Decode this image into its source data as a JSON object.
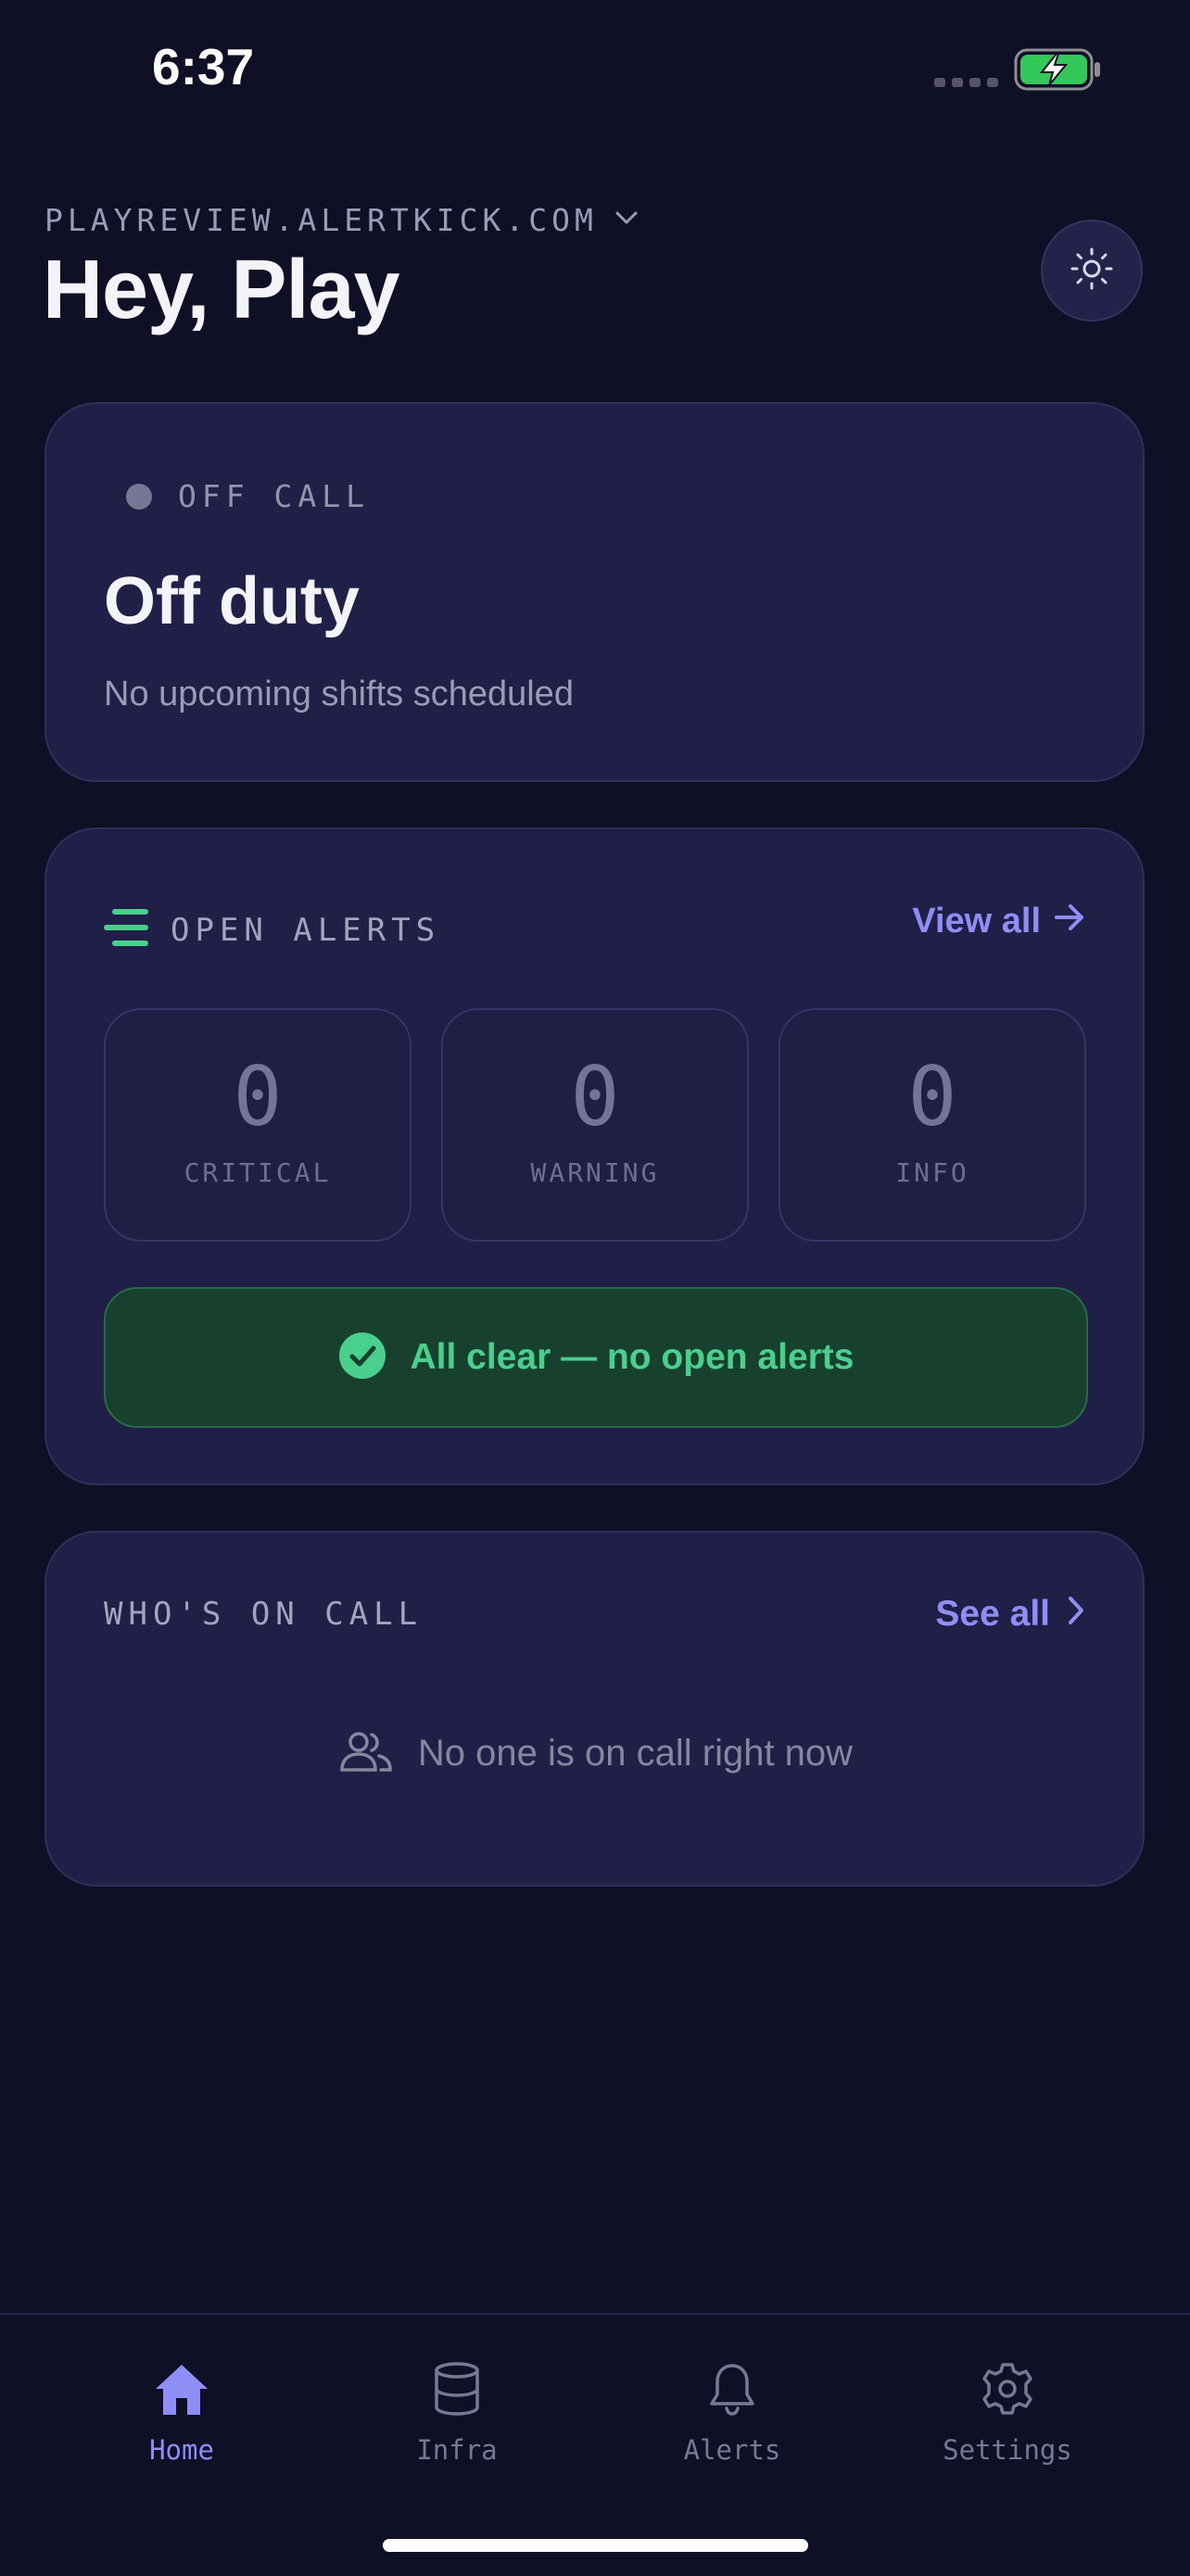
{
  "status_bar": {
    "time": "6:37"
  },
  "header": {
    "domain": "PLAYREVIEW.ALERTKICK.COM",
    "greeting": "Hey, Play"
  },
  "status_card": {
    "badge": "OFF CALL",
    "title": "Off duty",
    "subtitle": "No upcoming shifts scheduled"
  },
  "alerts_card": {
    "title": "OPEN ALERTS",
    "view_all": "View all",
    "counters": [
      {
        "value": "0",
        "label": "CRITICAL"
      },
      {
        "value": "0",
        "label": "WARNING"
      },
      {
        "value": "0",
        "label": "INFO"
      }
    ],
    "all_clear": "All clear — no open alerts"
  },
  "oncall_card": {
    "title": "WHO'S ON CALL",
    "see_all": "See all",
    "empty": "No one is on call right now"
  },
  "tabs": [
    {
      "label": "Home",
      "icon": "home-icon",
      "active": true
    },
    {
      "label": "Infra",
      "icon": "database-icon",
      "active": false
    },
    {
      "label": "Alerts",
      "icon": "bell-icon",
      "active": false
    },
    {
      "label": "Settings",
      "icon": "gear-icon",
      "active": false
    }
  ],
  "colors": {
    "background": "#0f0f26",
    "card": "#201f47",
    "accent": "#8f8ef5",
    "success": "#4ad08d",
    "battery": "#34c759"
  }
}
